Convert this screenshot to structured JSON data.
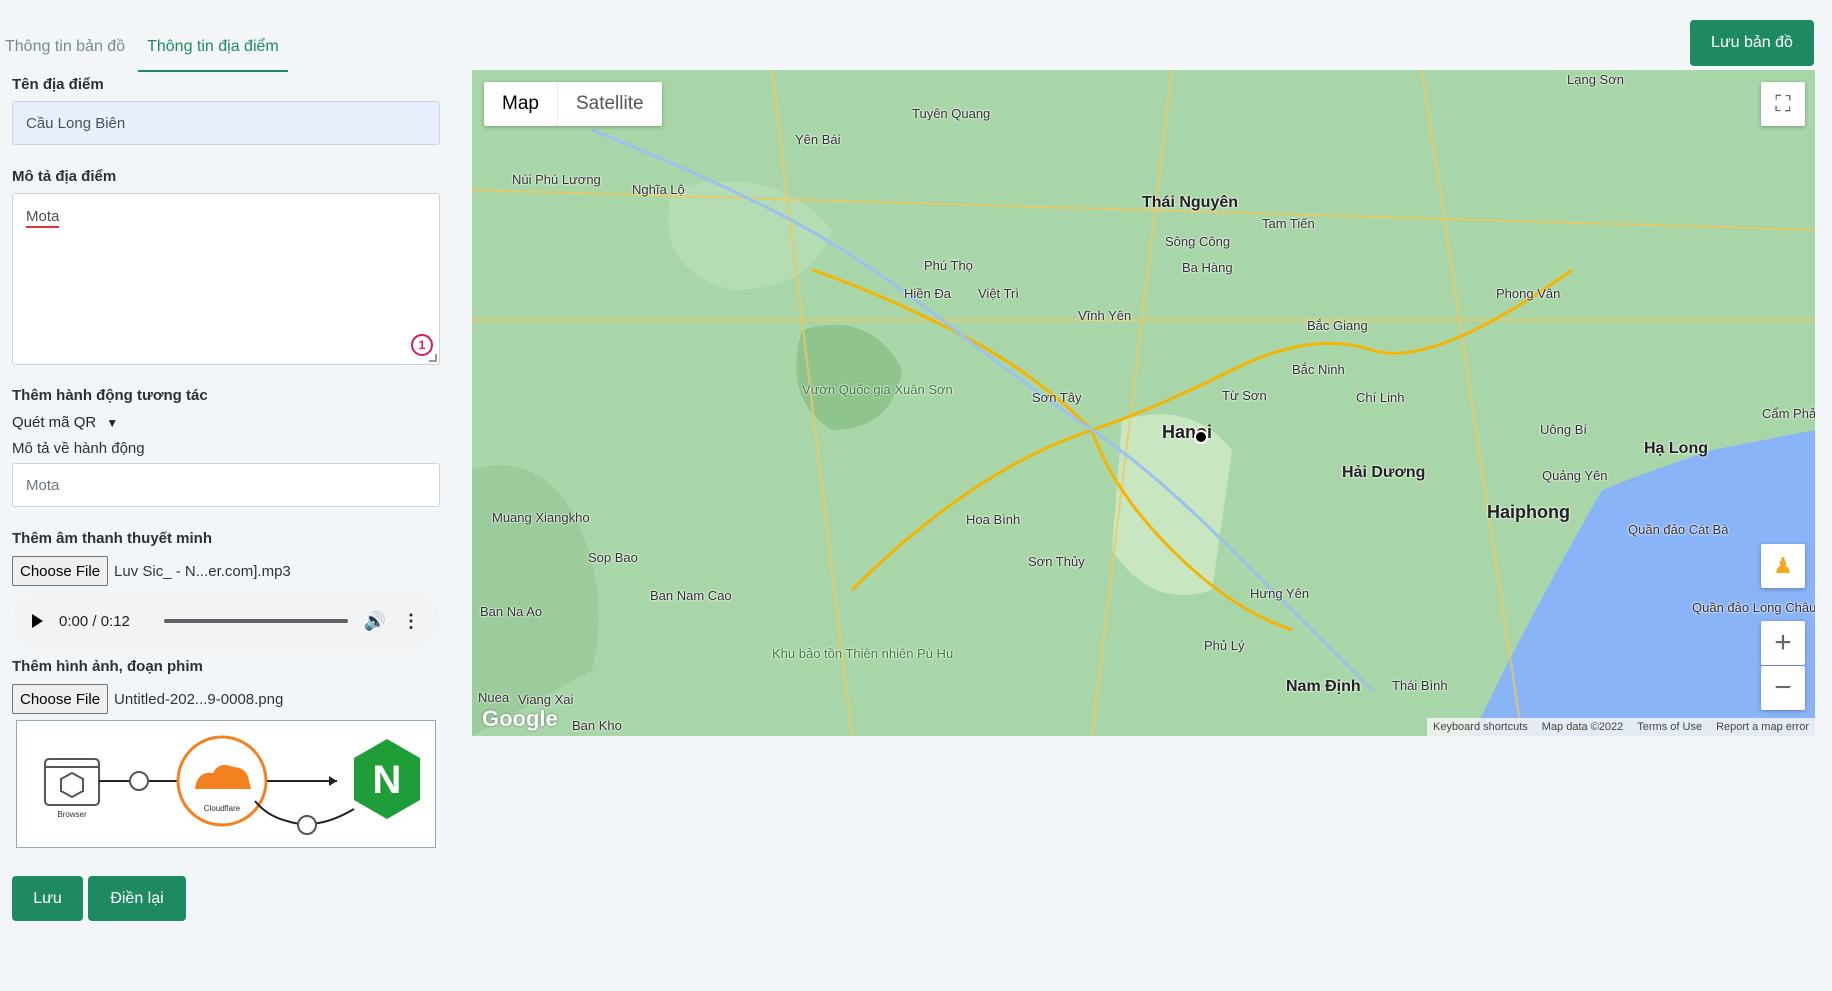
{
  "tabs": [
    {
      "label": "Thông tin bản đồ"
    },
    {
      "label": "Thông tin địa điểm"
    }
  ],
  "header": {
    "save_map_label": "Lưu bản đồ"
  },
  "form": {
    "place_name_label": "Tên địa điểm",
    "place_name_value": "Cầu Long Biên",
    "place_desc_label": "Mô tả địa điểm",
    "place_desc_value": "Mota",
    "place_desc_badge": "1",
    "action_label": "Thêm hành động tương tác",
    "action_select_value": "Quét mã QR",
    "action_desc_label": "Mô tả về hành động",
    "action_desc_placeholder": "Mota",
    "audio_label": "Thêm âm thanh thuyết minh",
    "audio_file_button": "Choose File",
    "audio_file_name": "Luv Sic_ - N...er.com].mp3",
    "audio_time": "0:00 / 0:12",
    "media_label": "Thêm hình ảnh, đoạn phim",
    "media_file_button": "Choose File",
    "media_file_name": "Untitled-202...9-0008.png",
    "preview_browser_label": "Browser",
    "preview_cloudflare_label": "Cloudflare",
    "preview_nginx_letter": "N",
    "save_label": "Lưu",
    "reset_label": "Điền lại"
  },
  "map": {
    "map_type_map": "Map",
    "map_type_satellite": "Satellite",
    "zoom_in": "+",
    "zoom_out": "−",
    "footer": [
      "Keyboard shortcuts",
      "Map data ©2022",
      "Terms of Use",
      "Report a map error"
    ],
    "logo": "Google",
    "places": {
      "lang_son": "Lạng Sơn",
      "tuyen_quang": "Tuyên Quang",
      "yen_bai": "Yên Bái",
      "thai_nguyen": "Thái Nguyên",
      "nui_phu": "Núi Phú Lương",
      "nghia_lo": "Nghĩa Lộ",
      "tam_tien": "Tam Tiến",
      "song_cong": "Sông Công",
      "ba_hang": "Ba Hàng",
      "phu_tho": "Phú Thọ",
      "hien_da": "Hiền Đa",
      "viet_tri": "Việt Trì",
      "vinh_yen": "Vĩnh Yên",
      "bac_giang": "Bắc Giang",
      "phong_van": "Phong Vân",
      "bac_ninh": "Bắc Ninh",
      "vuon_quoc_gia": "Vườn Quốc gia Xuân Sơn",
      "son_tay": "Sơn Tây",
      "tu_son": "Từ Sơn",
      "chi_linh": "Chí Linh",
      "cam_pha": "Cẩm Phả",
      "hanoi": "Hanoi",
      "uong_bi": "Uông Bí",
      "ha_long": "Hạ Long",
      "hai_duong": "Hải Dương",
      "quang_yen": "Quảng Yên",
      "haiphong": "Haiphong",
      "hoa_binh": "Hoa Bình",
      "muang": "Muang Xiangkho",
      "cat_ba": "Quần đảo Cát Bà",
      "son_thuy": "Sơn Thủy",
      "sop_bao": "Sop Bao",
      "hung_yen": "Hưng Yên",
      "ban_nam_cao": "Ban Nam Cao",
      "ban_na_ao": "Ban Na Ao",
      "long_chau": "Quần đảo Long Châu",
      "khu_bao_ton": "Khu bảo tồn Thiên nhiên Pù Hu",
      "phu_ly": "Phủ Lý",
      "nam_dinh": "Nam Định",
      "thai_binh": "Thái Bình",
      "nuea": "Nuea",
      "viang_xai": "Viang Xai",
      "ban_kho": "Ban Kho"
    }
  }
}
